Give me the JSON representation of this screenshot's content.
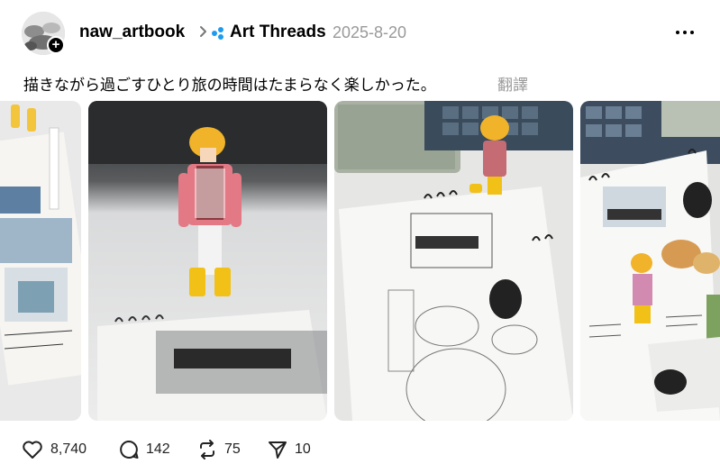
{
  "post": {
    "username": "naw_artbook",
    "community": "Art Threads",
    "date": "2025-8-20",
    "caption": "描きながら過ごすひとり旅の時間はたまらなく楽しかった。",
    "translate_label": "翻譯"
  },
  "images": [
    {
      "alt": "sketchbook with watercolor shop illustration"
    },
    {
      "alt": "toy figure standing on sketchbook with D&DEPARTMENT drawing"
    },
    {
      "alt": "sketchbook page pencil drawing with toy figure and paint palette"
    },
    {
      "alt": "finished watercolor sketchbook page with food drawings"
    }
  ],
  "actions": {
    "likes": "8,740",
    "comments": "142",
    "reposts": "75",
    "shares": "10"
  },
  "colors": {
    "accent_blue": "#1d9bf0",
    "muted": "#999999"
  }
}
